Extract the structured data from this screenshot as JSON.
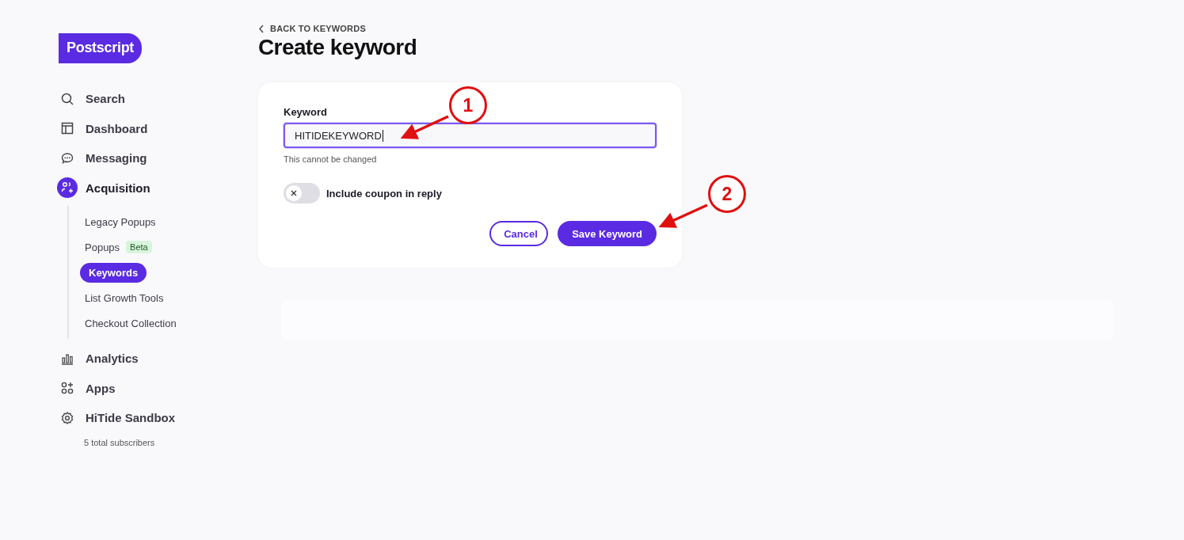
{
  "logo": "Postscript",
  "nav": [
    {
      "label": "Search",
      "kind": "search",
      "selected": false
    },
    {
      "label": "Dashboard",
      "kind": "dashboard",
      "selected": false
    },
    {
      "label": "Messaging",
      "kind": "messaging",
      "selected": false
    },
    {
      "label": "Acquisition",
      "kind": "acquisition",
      "selected": true,
      "children": [
        {
          "label": "Legacy Popups",
          "selected": false
        },
        {
          "label": "Popups",
          "badge": "Beta",
          "selected": false
        },
        {
          "label": "Keywords",
          "selected": true
        },
        {
          "label": "List Growth Tools",
          "selected": false
        },
        {
          "label": "Checkout Collection",
          "selected": false
        }
      ]
    },
    {
      "label": "Analytics",
      "kind": "analytics",
      "selected": false
    },
    {
      "label": "Apps",
      "kind": "apps",
      "selected": false
    },
    {
      "label": "HiTide Sandbox",
      "kind": "settings",
      "selected": false
    }
  ],
  "account_note": "5 total subscribers",
  "back_link": "BACK TO KEYWORDS",
  "title": "Create keyword",
  "form": {
    "field_label": "Keyword",
    "value": "HITIDEKEYWORD",
    "help": "This cannot be changed",
    "toggle": {
      "label": "Include coupon in reply",
      "on": false
    },
    "buttons": [
      {
        "label": "Cancel",
        "kind": "secondary"
      },
      {
        "label": "Save Keyword",
        "kind": "primary"
      }
    ]
  },
  "annotations": [
    {
      "label": "1"
    },
    {
      "label": "2"
    }
  ]
}
